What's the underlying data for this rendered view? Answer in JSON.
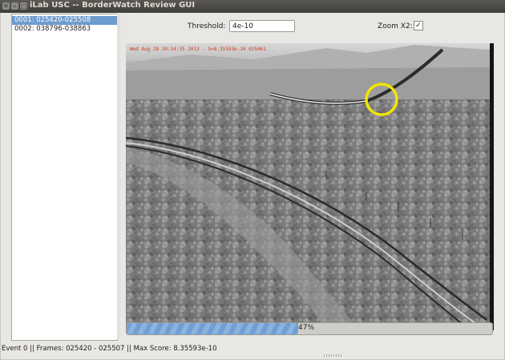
{
  "window": {
    "title": "iLab USC -- BorderWatch Review GUI"
  },
  "events_list": {
    "items": [
      {
        "label": "0001: 025420-025508",
        "selected": true
      },
      {
        "label": "0002: 038796-038863",
        "selected": false
      }
    ]
  },
  "controls": {
    "threshold_label": "Threshold:",
    "threshold_value": "4e-10",
    "zoom_label": "Zoom X2:",
    "zoom_checked": true
  },
  "video": {
    "overlay_text": "Wed Aug 28 20:14:35 2013 - S=8.35593e-10 025461",
    "highlight_color": "#f2e500"
  },
  "progress": {
    "percent": 47,
    "label": "47%"
  },
  "status": {
    "text": "Event 0 || Frames: 025420 - 025507 || Max Score: 8.35593e-10"
  },
  "colors": {
    "selection": "#6e9ccf",
    "progress_fill": "#6f9fd4"
  }
}
